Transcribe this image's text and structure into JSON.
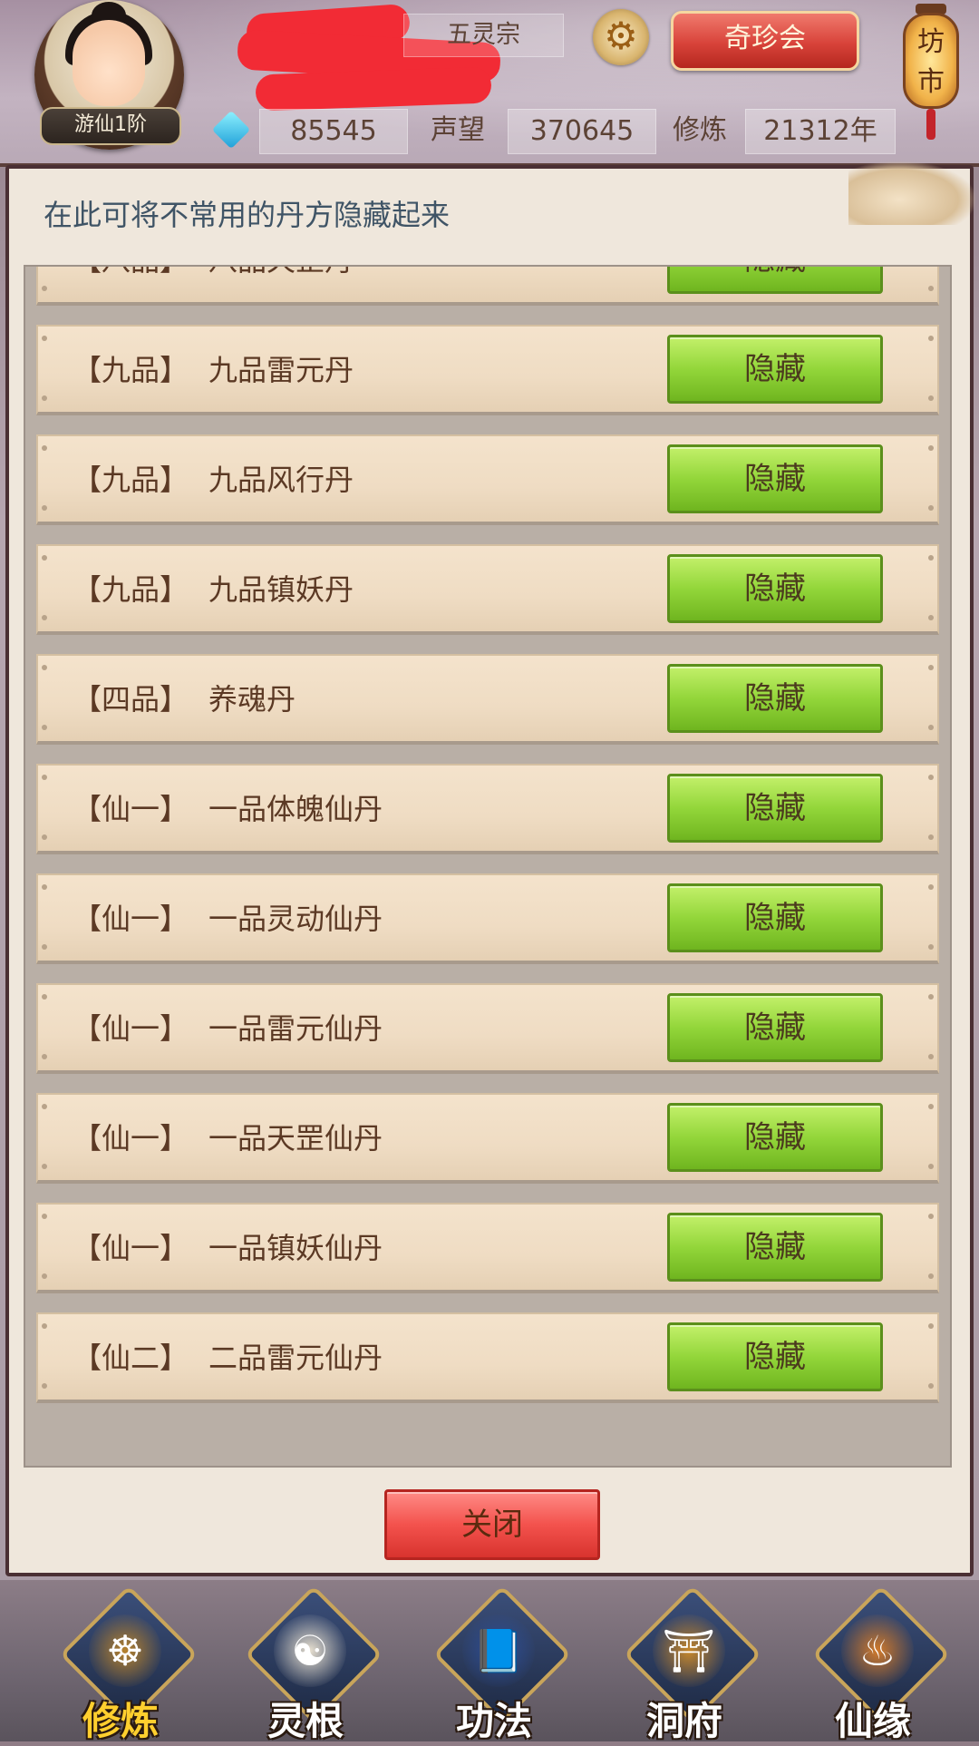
{
  "header": {
    "rank": "游仙1阶",
    "sect": "五灵宗",
    "treasure_button": "奇珍会",
    "market_sign": "坊市",
    "spirit_stones": "85545",
    "reputation_label": "声望",
    "reputation": "370645",
    "cultivation_label": "修炼",
    "cultivation": "21312年"
  },
  "panel": {
    "hint": "在此可将不常用的丹方隐藏起来",
    "hide_label": "隐藏",
    "close_label": "关闭",
    "rows": [
      {
        "tier": "【八品】",
        "name": "八品天罡丹"
      },
      {
        "tier": "【九品】",
        "name": "九品雷元丹"
      },
      {
        "tier": "【九品】",
        "name": "九品风行丹"
      },
      {
        "tier": "【九品】",
        "name": "九品镇妖丹"
      },
      {
        "tier": "【四品】",
        "name": "养魂丹"
      },
      {
        "tier": "【仙一】",
        "name": "一品体魄仙丹"
      },
      {
        "tier": "【仙一】",
        "name": "一品灵动仙丹"
      },
      {
        "tier": "【仙一】",
        "name": "一品雷元仙丹"
      },
      {
        "tier": "【仙一】",
        "name": "一品天罡仙丹"
      },
      {
        "tier": "【仙一】",
        "name": "一品镇妖仙丹"
      },
      {
        "tier": "【仙二】",
        "name": "二品雷元仙丹"
      }
    ]
  },
  "nav": [
    {
      "label": "修炼",
      "icon": "cultivate-icon"
    },
    {
      "label": "灵根",
      "icon": "spirit-root-icon"
    },
    {
      "label": "功法",
      "icon": "technique-icon"
    },
    {
      "label": "洞府",
      "icon": "cave-dwelling-icon"
    },
    {
      "label": "仙缘",
      "icon": "immortal-fate-icon"
    }
  ],
  "colors": {
    "hide_button": "#93d63a",
    "close_button": "#f3524d",
    "active_nav": "#ffcf2e"
  }
}
